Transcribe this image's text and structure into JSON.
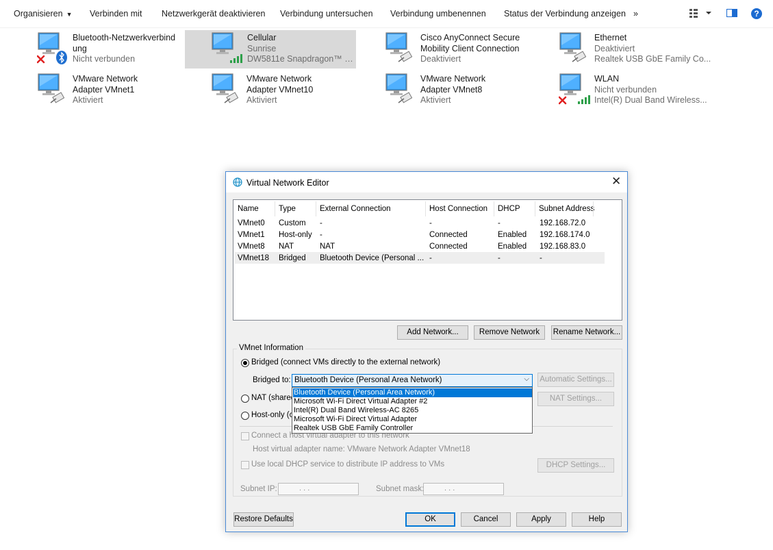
{
  "toolbar": {
    "organize": "Organisieren",
    "connect": "Verbinden mit",
    "disable": "Netzwerkgerät deaktivieren",
    "diagnose": "Verbindung untersuchen",
    "rename": "Verbindung umbenennen",
    "status": "Status der Verbindung anzeigen",
    "more": "»",
    "help": "?"
  },
  "adapters": [
    {
      "name": "Bluetooth-Netzwerkverbindung",
      "status": "Nicht verbunden",
      "detail": "",
      "icon": "bluetooth-adapter-icon"
    },
    {
      "name": "Cellular",
      "status": "Sunrise",
      "detail": "DW5811e Snapdragon™ X7 ...",
      "icon": "cellular-adapter-icon"
    },
    {
      "name": "Cisco AnyConnect Secure Mobility Client Connection",
      "status": "Deaktiviert",
      "detail": "",
      "icon": "ethernet-adapter-icon"
    },
    {
      "name": "Ethernet",
      "status": "Deaktiviert",
      "detail": "Realtek USB GbE Family Co...",
      "icon": "ethernet-adapter-icon"
    },
    {
      "name": "VMware Network Adapter VMnet1",
      "status": "Aktiviert",
      "detail": "",
      "icon": "ethernet-adapter-icon"
    },
    {
      "name": "VMware Network Adapter VMnet10",
      "status": "Aktiviert",
      "detail": "",
      "icon": "ethernet-adapter-icon"
    },
    {
      "name": "VMware Network Adapter VMnet8",
      "status": "Aktiviert",
      "detail": "",
      "icon": "ethernet-adapter-icon"
    },
    {
      "name": "WLAN",
      "status": "Nicht verbunden",
      "detail": "Intel(R) Dual Band Wireless...",
      "icon": "wlan-adapter-icon"
    }
  ],
  "dialog": {
    "title": "Virtual Network Editor",
    "columns": [
      "Name",
      "Type",
      "External Connection",
      "Host Connection",
      "DHCP",
      "Subnet Address"
    ],
    "rows": [
      [
        "VMnet0",
        "Custom",
        "-",
        "-",
        "-",
        "192.168.72.0"
      ],
      [
        "VMnet1",
        "Host-only",
        "-",
        "Connected",
        "Enabled",
        "192.168.174.0"
      ],
      [
        "VMnet8",
        "NAT",
        "NAT",
        "Connected",
        "Enabled",
        "192.168.83.0"
      ],
      [
        "VMnet18",
        "Bridged",
        "Bluetooth Device (Personal ...",
        "-",
        "-",
        "-"
      ]
    ],
    "add_network": "Add Network...",
    "remove_network": "Remove Network",
    "rename_network": "Rename Network...",
    "group_title": "VMnet Information",
    "bridged_label": "Bridged (connect VMs directly to the external network)",
    "bridged_to_label": "Bridged to:",
    "bridged_to_value": "Bluetooth Device (Personal Area Network)",
    "bridged_options": [
      "Bluetooth Device (Personal Area Network)",
      "Microsoft Wi-Fi Direct Virtual Adapter #2",
      "Intel(R) Dual Band Wireless-AC 8265",
      "Microsoft Wi-Fi Direct Virtual Adapter",
      "Realtek USB GbE Family Controller"
    ],
    "automatic_settings": "Automatic Settings...",
    "nat_label": "NAT (shared",
    "nat_settings": "NAT Settings...",
    "hostonly_label": "Host-only (c",
    "connect_host_adapter": "Connect a host virtual adapter to this network",
    "host_adapter_name": "Host virtual adapter name: VMware Network Adapter VMnet18",
    "use_dhcp": "Use local DHCP service to distribute IP address to VMs",
    "dhcp_settings": "DHCP Settings...",
    "subnet_ip_label": "Subnet IP:",
    "subnet_mask_label": "Subnet mask:",
    "ip_placeholder": ".       .       .",
    "restore_defaults": "Restore Defaults",
    "ok": "OK",
    "cancel": "Cancel",
    "apply": "Apply",
    "help": "Help"
  }
}
